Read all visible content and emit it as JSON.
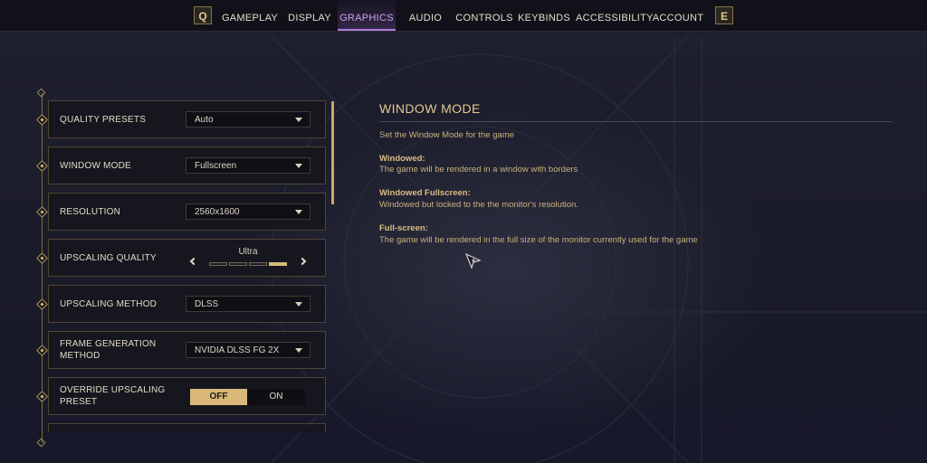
{
  "nav": {
    "left_key": "Q",
    "right_key": "E",
    "tabs": [
      {
        "label": "GAMEPLAY"
      },
      {
        "label": "DISPLAY"
      },
      {
        "label": "GRAPHICS"
      },
      {
        "label": "AUDIO"
      },
      {
        "label": "CONTROLS"
      },
      {
        "label": "KEYBINDS"
      },
      {
        "label": "ACCESSIBILITY"
      },
      {
        "label": "ACCOUNT"
      }
    ],
    "active_tab": "GRAPHICS"
  },
  "settings": {
    "quality_presets": {
      "label": "QUALITY PRESETS",
      "value": "Auto"
    },
    "window_mode": {
      "label": "WINDOW MODE",
      "value": "Fullscreen"
    },
    "resolution": {
      "label": "RESOLUTION",
      "value": "2560x1600"
    },
    "upscaling_quality": {
      "label": "UPSCALING QUALITY",
      "value": "Ultra",
      "level": 4,
      "max_level": 4
    },
    "upscaling_method": {
      "label": "UPSCALING METHOD",
      "value": "DLSS"
    },
    "frame_generation": {
      "label_line1": "FRAME GENERATION",
      "label_line2": "METHOD",
      "value": "NVIDIA DLSS FG 2X"
    },
    "override_upscaling": {
      "label_line1": "OVERRIDE UPSCALING",
      "label_line2": "PRESET",
      "off_label": "OFF",
      "on_label": "ON",
      "selected": "OFF"
    }
  },
  "panel": {
    "title": "WINDOW MODE",
    "intro": "Set the Window Mode for the game",
    "sections": [
      {
        "heading": "Windowed:",
        "text": "The game will be rendered in a window with borders"
      },
      {
        "heading": "Windowed Fullscreen:",
        "text": "Windowed but locked to the the monitor's resolution."
      },
      {
        "heading": "Full-screen:",
        "text": "The game will be rendered in the full size of the monitor currently used for the game"
      }
    ]
  },
  "colors": {
    "accent_gold": "#d9b87a",
    "active_tab_purple": "#b07de0",
    "background": "#1a1b28"
  },
  "icons": {
    "dropdown": "chevron-down-icon",
    "slider_prev": "chevron-left-icon",
    "slider_next": "chevron-right-icon",
    "row_marker": "diamond-icon",
    "cursor": "cursor-icon"
  }
}
